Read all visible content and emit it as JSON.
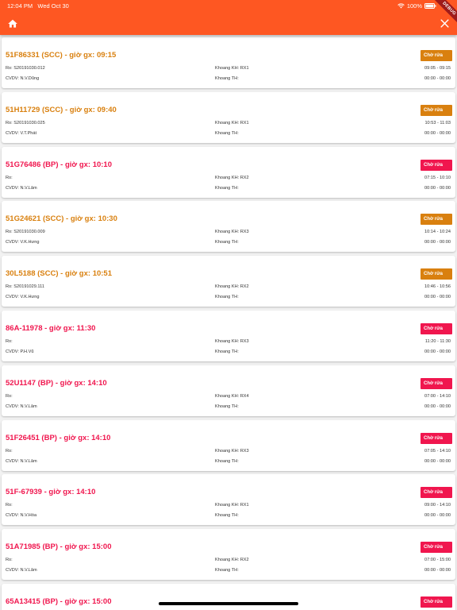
{
  "status_bar": {
    "time": "12:04 PM",
    "date": "Wed Oct 30",
    "battery": "100%"
  },
  "debug_banner": "DEBUG",
  "icons": {
    "home": "home-icon",
    "close": "close-icon",
    "wifi": "wifi-icon",
    "battery": "battery-icon"
  },
  "colors": {
    "header": "#FE5722",
    "orange": "#D9800F",
    "red": "#F0164E"
  },
  "labels": {
    "ro": "Ro:",
    "cvdv": "CVDV:",
    "khoang_kh": "Khoang KH:",
    "khoang_th": "Khoang TH:"
  },
  "cards": [
    {
      "title": "51F86331 (SCC) - giờ gx: 09:15",
      "status": "Chờ rửa",
      "color": "orange",
      "ro": "Ro: S20191030.012",
      "khoang_kh": "Khoang KH: RX1",
      "time1": "09:05 - 09:15",
      "cvdv": "CVDV: N.V.Dũng",
      "khoang_th": "Khoang TH:",
      "time2": "00:00 - 00:00"
    },
    {
      "title": "51H11729 (SCC) - giờ gx: 09:40",
      "status": "Chờ rửa",
      "color": "orange",
      "ro": "Ro: S20191030.025",
      "khoang_kh": "Khoang KH: RX1",
      "time1": "10:53 - 11:03",
      "cvdv": "CVDV: V.T.Phát",
      "khoang_th": "Khoang TH:",
      "time2": "00:00 - 00:00"
    },
    {
      "title": "51G76486 (BP) - giờ gx: 10:10",
      "status": "Chờ rửa",
      "color": "red",
      "ro": "Ro:",
      "khoang_kh": "Khoang KH: RX2",
      "time1": "07:15 - 10:10",
      "cvdv": "CVDV: N.V.Lâm",
      "khoang_th": "Khoang TH:",
      "time2": "00:00 - 00:00"
    },
    {
      "title": "51G24621 (SCC) - giờ gx: 10:30",
      "status": "Chờ rửa",
      "color": "orange",
      "ro": "Ro: S20191030.009",
      "khoang_kh": "Khoang KH: RX3",
      "time1": "10:14 - 10:24",
      "cvdv": "CVDV: V.K.Hưng",
      "khoang_th": "Khoang TH:",
      "time2": "00:00 - 00:00"
    },
    {
      "title": "30L5188 (SCC) - giờ gx: 10:51",
      "status": "Chờ rửa",
      "color": "orange",
      "ro": "Ro: S20191029.111",
      "khoang_kh": "Khoang KH: RX2",
      "time1": "10:46 - 10:56",
      "cvdv": "CVDV: V.K.Hưng",
      "khoang_th": "Khoang TH:",
      "time2": "00:00 - 00:00"
    },
    {
      "title": "86A-11978 - giờ gx: 11:30",
      "status": "Chờ rửa",
      "color": "red",
      "ro": "Ro:",
      "khoang_kh": "Khoang KH: RX3",
      "time1": "11:20 - 11:30",
      "cvdv": "CVDV: P.H.Vũ",
      "khoang_th": "Khoang TH:",
      "time2": "00:00 - 00:00"
    },
    {
      "title": "52U1147 (BP) - giờ gx: 14:10",
      "status": "Chờ rửa",
      "color": "red",
      "ro": "Ro:",
      "khoang_kh": "Khoang KH: RX4",
      "time1": "07:00 - 14:10",
      "cvdv": "CVDV: N.V.Lâm",
      "khoang_th": "Khoang TH:",
      "time2": "00:00 - 00:00"
    },
    {
      "title": "51F26451 (BP) - giờ gx: 14:10",
      "status": "Chờ rửa",
      "color": "red",
      "ro": "Ro:",
      "khoang_kh": "Khoang KH: RX3",
      "time1": "07:05 - 14:10",
      "cvdv": "CVDV: N.V.Lâm",
      "khoang_th": "Khoang TH:",
      "time2": "00:00 - 00:00"
    },
    {
      "title": "51F-67939 - giờ gx: 14:10",
      "status": "Chờ rửa",
      "color": "red",
      "ro": "Ro:",
      "khoang_kh": "Khoang KH: RX1",
      "time1": "09:00 - 14:10",
      "cvdv": "CVDV: N.V.Hòa",
      "khoang_th": "Khoang TH:",
      "time2": "00:00 - 00:00"
    },
    {
      "title": "51A71985 (BP) - giờ gx: 15:00",
      "status": "Chờ rửa",
      "color": "red",
      "ro": "Ro:",
      "khoang_kh": "Khoang KH: RX2",
      "time1": "07:00 - 15:00",
      "cvdv": "CVDV: N.V.Lâm",
      "khoang_th": "Khoang TH:",
      "time2": "00:00 - 00:00"
    },
    {
      "title": "65A13415 (BP) - giờ gx: 15:00",
      "status": "Chờ rửa",
      "color": "red",
      "ro": "",
      "khoang_kh": "",
      "time1": "",
      "cvdv": "",
      "khoang_th": "",
      "time2": ""
    }
  ]
}
